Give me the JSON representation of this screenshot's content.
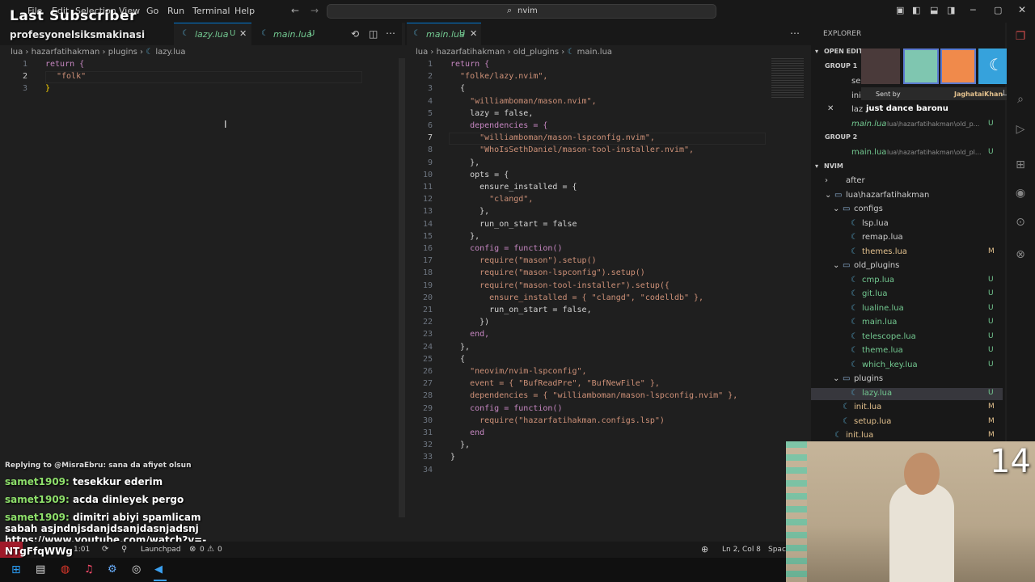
{
  "titlebar": {
    "menu": [
      "File",
      "Edit",
      "Selection",
      "View",
      "Go",
      "Run",
      "Terminal",
      "Help"
    ],
    "command_center": "nvim"
  },
  "overlay": {
    "title": "Last Subscriber",
    "subscriber": "profesyonelsiksmakinasi",
    "counter": "14",
    "reward_sender": "Sent by",
    "reward_user": "JaghataiKhan",
    "reward_text": "just dance baronu"
  },
  "left_editor": {
    "tabs": [
      {
        "label": "lazy.lua",
        "status": "U",
        "active": true
      },
      {
        "label": "main.lua",
        "status": "U",
        "active": false
      }
    ],
    "breadcrumb": [
      "lua",
      "hazarfatihakman",
      "plugins",
      "lazy.lua"
    ],
    "lines": [
      {
        "n": "1",
        "text": "return {"
      },
      {
        "n": "2",
        "text": "\"folk\""
      },
      {
        "n": "3",
        "text": "}"
      }
    ]
  },
  "right_editor": {
    "tabs": [
      {
        "label": "main.lua",
        "status": "U",
        "active": true
      }
    ],
    "breadcrumb": [
      "lua",
      "hazarfatihakman",
      "old_plugins",
      "main.lua"
    ],
    "lines": [
      "return {",
      "  \"folke/lazy.nvim\",",
      "  {",
      "    \"williamboman/mason.nvim\",",
      "    lazy = false,",
      "    dependencies = {",
      "      \"williamboman/mason-lspconfig.nvim\",",
      "      \"WhoIsSethDaniel/mason-tool-installer.nvim\",",
      "    },",
      "    opts = {",
      "      ensure_installed = {",
      "        \"clangd\",",
      "      },",
      "      run_on_start = false",
      "    },",
      "    config = function()",
      "      require(\"mason\").setup()",
      "      require(\"mason-lspconfig\").setup()",
      "      require(\"mason-tool-installer\").setup({",
      "        ensure_installed = { \"clangd\", \"codelldb\" },",
      "        run_on_start = false,",
      "      })",
      "    end,",
      "  },",
      "  {",
      "    \"neovim/nvim-lspconfig\",",
      "    event = { \"BufReadPre\", \"BufNewFile\" },",
      "    dependencies = { \"williamboman/mason-lspconfig.nvim\" },",
      "    config = function()",
      "      require(\"hazarfatihakman.configs.lsp\")",
      "    end",
      "  },",
      "}",
      ""
    ]
  },
  "explorer": {
    "title": "EXPLORER",
    "open_editors": "OPEN EDITORS",
    "group1": "GROUP 1",
    "group2": "GROUP 2",
    "group1_items": [
      {
        "label": "se",
        "status": ""
      },
      {
        "label": "ini",
        "status": ""
      },
      {
        "label": "laz",
        "status": ""
      },
      {
        "label": "main.lua",
        "path": "lua\\hazarfatihakman\\old_p...",
        "status": "U"
      }
    ],
    "group2_items": [
      {
        "label": "main.lua",
        "path": "lua\\hazarfatihakman\\old_pl...",
        "status": "U"
      }
    ],
    "root": "NVIM",
    "tree": [
      {
        "label": "after",
        "status": "",
        "depth": 1
      },
      {
        "label": "lua\\hazarfatihakman",
        "status": "",
        "depth": 1
      },
      {
        "label": "configs",
        "status": "",
        "depth": 2
      },
      {
        "label": "lsp.lua",
        "status": "",
        "depth": 3
      },
      {
        "label": "remap.lua",
        "status": "",
        "depth": 3
      },
      {
        "label": "themes.lua",
        "status": "M",
        "depth": 3
      },
      {
        "label": "old_plugins",
        "status": "",
        "depth": 2
      },
      {
        "label": "cmp.lua",
        "status": "U",
        "depth": 3
      },
      {
        "label": "git.lua",
        "status": "U",
        "depth": 3
      },
      {
        "label": "lualine.lua",
        "status": "U",
        "depth": 3
      },
      {
        "label": "main.lua",
        "status": "U",
        "depth": 3
      },
      {
        "label": "telescope.lua",
        "status": "U",
        "depth": 3
      },
      {
        "label": "theme.lua",
        "status": "U",
        "depth": 3
      },
      {
        "label": "which_key.lua",
        "status": "U",
        "depth": 3
      },
      {
        "label": "plugins",
        "status": "",
        "depth": 2
      },
      {
        "label": "lazy.lua",
        "status": "U",
        "depth": 3
      },
      {
        "label": "init.lua",
        "status": "M",
        "depth": 2
      },
      {
        "label": "setup.lua",
        "status": "M",
        "depth": 2
      },
      {
        "label": "init.lua",
        "status": "M",
        "depth": 1
      }
    ]
  },
  "chat": [
    {
      "user": "",
      "text": "Replying to @MisraEbru: sana da afiyet olsun"
    },
    {
      "user": "samet1909:",
      "text": "tesekkur ederim"
    },
    {
      "user": "samet1909:",
      "text": "acda dinleyek pergo"
    },
    {
      "user": "samet1909:",
      "text": "dimitri abiyi spamlicam"
    },
    {
      "user": "",
      "text": "sabah asjndnjsdanjdsanjdasnjadsnj"
    },
    {
      "user": "",
      "text": "https://www.youtube.com/watch?v=-"
    },
    {
      "user": "",
      "text": "NTgFfqWWg"
    }
  ],
  "status": {
    "position": "Ln 2, Col 8",
    "spaces": "Spac",
    "errors": "0",
    "warnings": "0",
    "launchpad": "Launchpad",
    "time": "1:01"
  },
  "colors": {
    "accent": "#0078d4",
    "untracked": "#73c991",
    "modified": "#e2c08d"
  }
}
